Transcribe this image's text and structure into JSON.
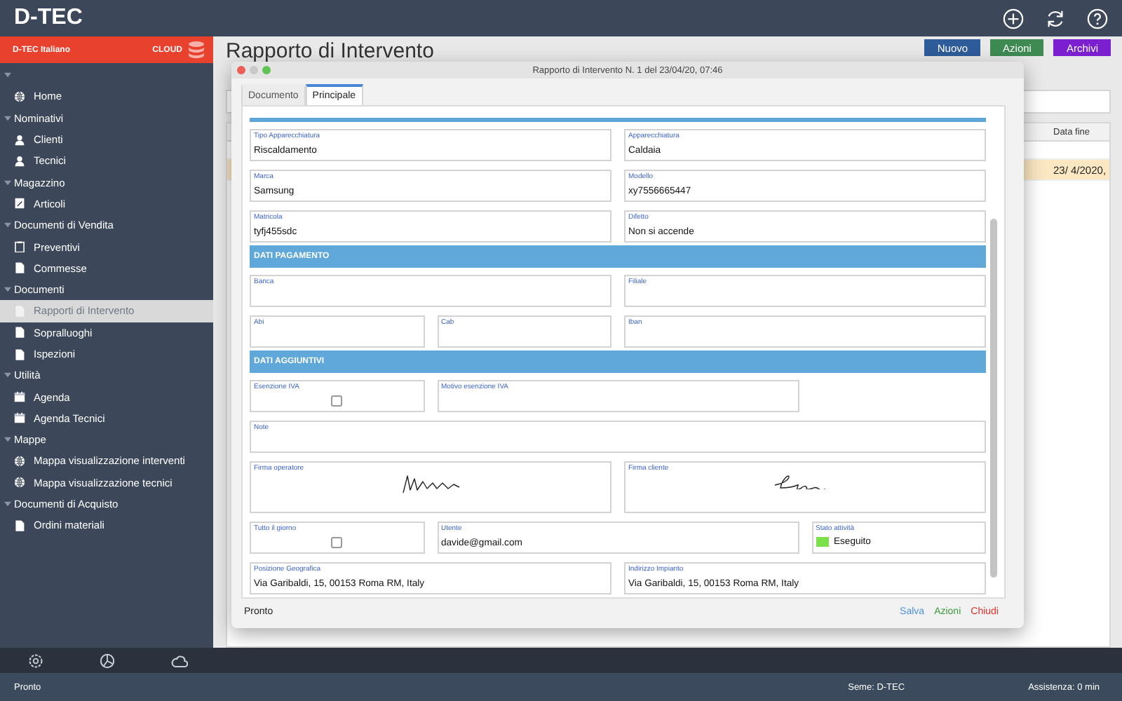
{
  "app": {
    "title": "D-TEC"
  },
  "sidebar": {
    "account": "D-TEC Italiano",
    "cloud": "CLOUD",
    "groups": [
      {
        "expanded": true,
        "items": [
          {
            "label": "Home",
            "kind": "globe",
            "selected": false
          }
        ]
      },
      {
        "label": "Nominativi",
        "expanded": true,
        "items": [
          {
            "label": "Clienti",
            "kind": "person",
            "selected": false
          },
          {
            "label": "Tecnici",
            "kind": "person",
            "selected": false
          }
        ]
      },
      {
        "label": "Magazzino",
        "expanded": true,
        "items": [
          {
            "label": "Articoli",
            "kind": "edit",
            "selected": false
          }
        ]
      },
      {
        "label": "Documenti di Vendita",
        "expanded": true,
        "items": [
          {
            "label": "Preventivi",
            "kind": "clipboard",
            "selected": false
          },
          {
            "label": "Commesse",
            "kind": "doc",
            "selected": false
          }
        ]
      },
      {
        "label": "Documenti",
        "expanded": true,
        "items": [
          {
            "label": "Rapporti di Intervento",
            "kind": "doc",
            "selected": true
          },
          {
            "label": "Sopralluoghi",
            "kind": "doc",
            "selected": false
          },
          {
            "label": "Ispezioni",
            "kind": "doc",
            "selected": false
          }
        ]
      },
      {
        "label": "Utilità",
        "expanded": true,
        "items": [
          {
            "label": "Agenda",
            "kind": "calendar",
            "selected": false
          },
          {
            "label": "Agenda Tecnici",
            "kind": "calendar",
            "selected": false
          }
        ]
      },
      {
        "label": "Mappe",
        "expanded": true,
        "items": [
          {
            "label": "Mappa visualizzazione interventi",
            "kind": "globe",
            "selected": false
          },
          {
            "label": "Mappa visualizzazione tecnici",
            "kind": "globe",
            "selected": false
          }
        ]
      },
      {
        "label": "Documenti di Acquisto",
        "expanded": true,
        "items": [
          {
            "label": "Ordini materiali",
            "kind": "doc",
            "selected": false
          }
        ]
      }
    ]
  },
  "page": {
    "title": "Rapporto di Intervento",
    "buttons": [
      {
        "label": "Nuovo",
        "color": "#2e5c9a"
      },
      {
        "label": "Azioni",
        "color": "#3f8a52"
      },
      {
        "label": "Archivi",
        "color": "#7b1fd0"
      }
    ],
    "table": {
      "header": "Data fine",
      "rows": [
        {
          "cell": "",
          "selected": false
        },
        {
          "cell": "23/ 4/2020,",
          "selected": true
        }
      ]
    }
  },
  "dialog": {
    "title": "Rapporto di Intervento N. 1 del 23/04/20, 07:46",
    "tabs": [
      {
        "label": "Documento",
        "selected": false
      },
      {
        "label": "Principale",
        "selected": true
      }
    ],
    "rows": [
      {
        "kind": "fields",
        "fields": [
          {
            "kind": "text",
            "label": "Tipo Apparecchiatura",
            "value": "Riscaldamento"
          },
          {
            "kind": "text",
            "label": "Apparecchiatura",
            "value": "Caldaia"
          }
        ]
      },
      {
        "kind": "fields",
        "fields": [
          {
            "kind": "text",
            "label": "Marca",
            "value": "Samsung"
          },
          {
            "kind": "text",
            "label": "Modello",
            "value": "xy7556665447"
          }
        ]
      },
      {
        "kind": "fields",
        "fields": [
          {
            "kind": "text",
            "label": "Matricola",
            "value": "tyfj455sdc"
          },
          {
            "kind": "text",
            "label": "Difetto",
            "value": "Non si accende"
          }
        ]
      },
      {
        "kind": "header",
        "title": "DATI PAGAMENTO"
      },
      {
        "kind": "fields",
        "fields": [
          {
            "kind": "text",
            "label": "Banca"
          },
          {
            "kind": "text",
            "label": "Filiale"
          }
        ]
      },
      {
        "kind": "fields",
        "fields": [
          {
            "kind": "text",
            "label": "Abi"
          },
          {
            "kind": "text",
            "label": "Cab"
          },
          {
            "kind": "text",
            "label": "Iban"
          }
        ]
      },
      {
        "kind": "header",
        "title": "DATI AGGIUNTIVI"
      },
      {
        "kind": "fields",
        "fields": [
          {
            "kind": "check",
            "label": "Esenzione IVA",
            "checked": false
          },
          {
            "kind": "text",
            "label": "Motivo esenzione IVA"
          }
        ]
      },
      {
        "kind": "fields",
        "fields": [
          {
            "kind": "text",
            "label": "Note"
          }
        ]
      },
      {
        "kind": "fields",
        "fields": [
          {
            "kind": "signature",
            "label": "Firma operatore"
          },
          {
            "kind": "signature",
            "label": "Firma cliente"
          }
        ]
      },
      {
        "kind": "fields",
        "fields": [
          {
            "kind": "check",
            "label": "Tutto il giorno",
            "checked": false
          },
          {
            "kind": "text",
            "label": "Utente",
            "value": "davide@gmail.com"
          },
          {
            "kind": "status",
            "label": "Stato attività",
            "value": "Eseguito",
            "color": "#7be04a"
          }
        ]
      },
      {
        "kind": "fields",
        "fields": [
          {
            "kind": "text",
            "label": "Posizione Geografica",
            "value": "Via Garibaldi, 15, 00153 Roma RM, Italy"
          },
          {
            "kind": "text",
            "label": "Indirizzo Impianto",
            "value": "Via Garibaldi, 15, 00153 Roma RM, Italy"
          }
        ]
      }
    ],
    "status": "Pronto",
    "actions": [
      {
        "label": "Salva",
        "color": "#4a90e2"
      },
      {
        "label": "Azioni",
        "color": "#3d9a3d"
      },
      {
        "label": "Chiudi",
        "color": "#e0302a"
      }
    ]
  },
  "status_bar": {
    "left": "Pronto",
    "seed": "Seme: D-TEC",
    "support": "Assistenza: 0 min"
  }
}
